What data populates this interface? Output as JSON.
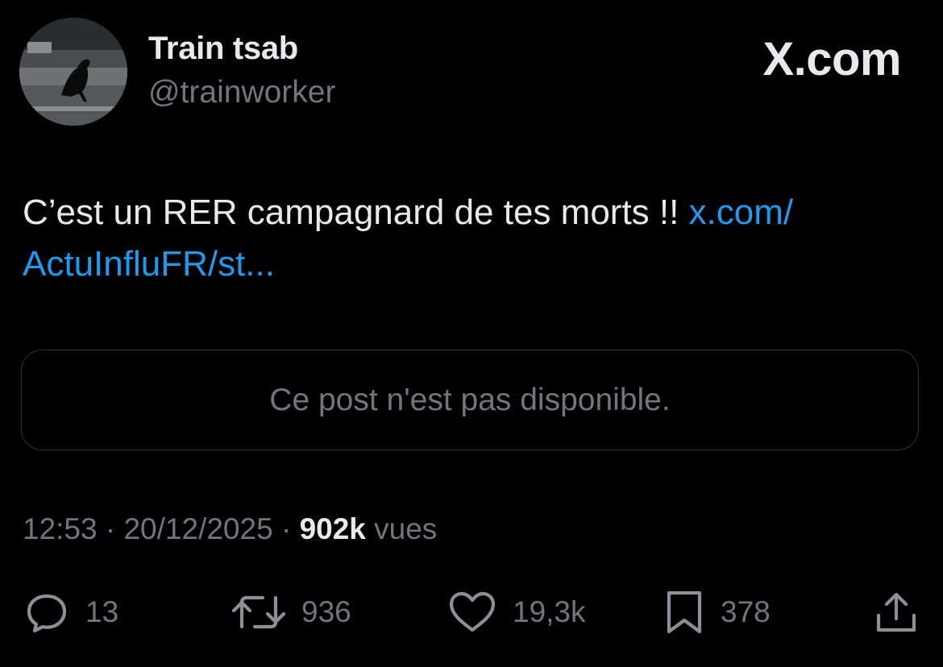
{
  "author": {
    "display_name": "Train tsab",
    "handle": "@trainworker"
  },
  "brand": {
    "label": "X.com"
  },
  "tweet": {
    "text": "C’est un RER campagnard de tes morts !! ",
    "link_text": "x.com/ ActuInfluFR/st..."
  },
  "quoted_post": {
    "unavailable_message": "Ce post n'est pas disponible."
  },
  "meta": {
    "time": "12:53",
    "separator": " · ",
    "date": "20/12/2025",
    "views_count": "902k",
    "views_label": " vues"
  },
  "actions": {
    "replies": "13",
    "reposts": "936",
    "likes": "19,3k",
    "bookmarks": "378"
  },
  "icons": {
    "reply": "speech-bubble-icon",
    "repost": "repost-arrows-icon",
    "like": "heart-icon",
    "bookmark": "bookmark-icon",
    "share": "share-upload-icon",
    "brand": "x-logo-icon"
  },
  "colors": {
    "background": "#000000",
    "primary_text": "#e7e9ea",
    "secondary_text": "#71767b",
    "link": "#1d9bf0",
    "border": "#2f3336"
  }
}
